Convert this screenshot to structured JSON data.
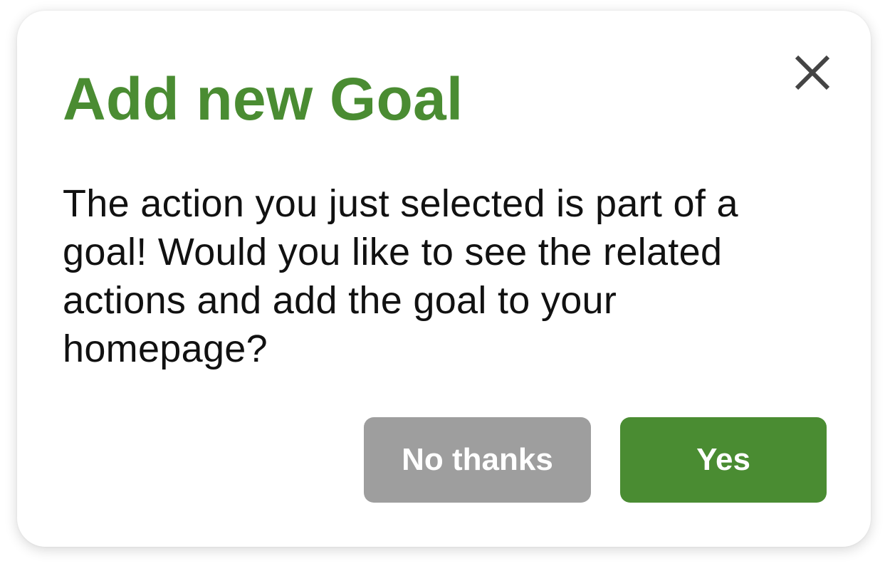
{
  "dialog": {
    "title": "Add new Goal",
    "message": "The action you just selected is part of a goal! Would you like to see the related actions and add the goal to your homepage?",
    "close_icon": "close-icon",
    "buttons": {
      "decline_label": "No thanks",
      "confirm_label": "Yes"
    }
  },
  "colors": {
    "accent": "#4a8c32",
    "secondary_button": "#9e9e9e",
    "text": "#111111",
    "icon": "#444444"
  }
}
